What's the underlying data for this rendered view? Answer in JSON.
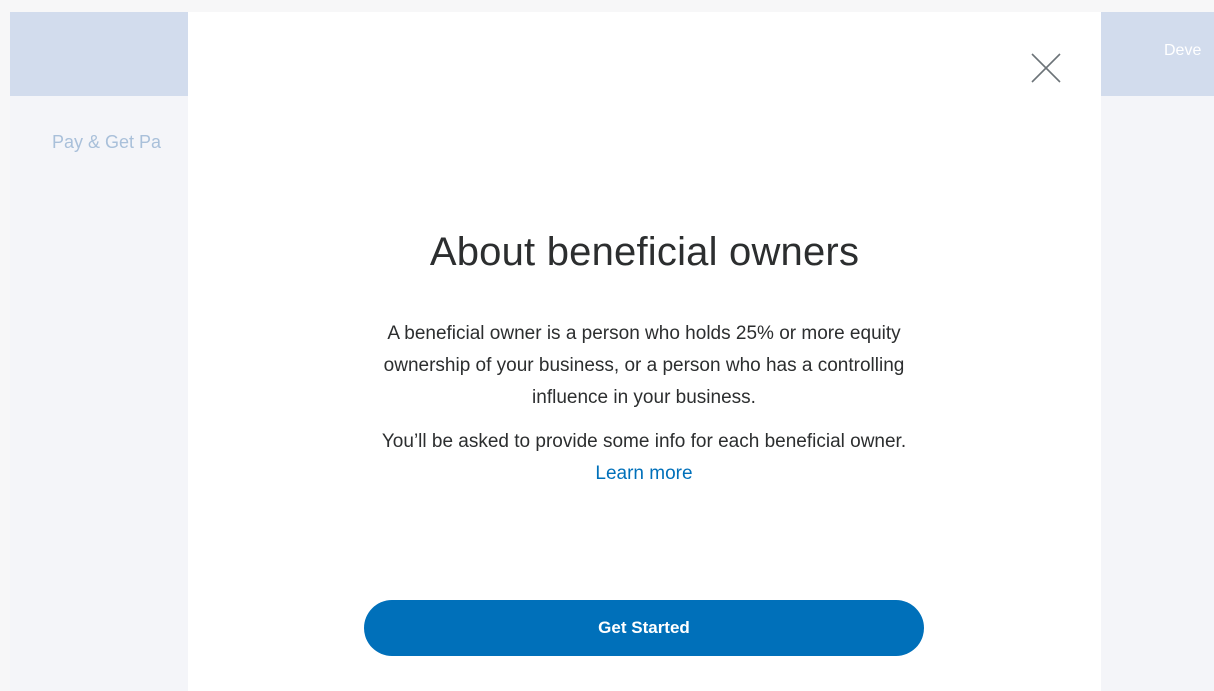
{
  "background": {
    "topbar_right_label": "Deve",
    "subnav_label": "Pay & Get Pa"
  },
  "modal": {
    "close_icon": "close-icon",
    "title": "About beneficial owners",
    "paragraph_1": "A beneficial owner is a person who holds 25% or more equity ownership of your business, or a person who has a controlling influence in your business.",
    "paragraph_2_text": "You’ll be asked to provide some info for each beneficial owner.",
    "learn_more_label": "Learn more",
    "primary_button_label": "Get Started"
  },
  "colors": {
    "brand_blue": "#0070ba",
    "topbar": "#d2dced",
    "page_bg": "#f4f5f9",
    "text": "#2c2e2f"
  }
}
